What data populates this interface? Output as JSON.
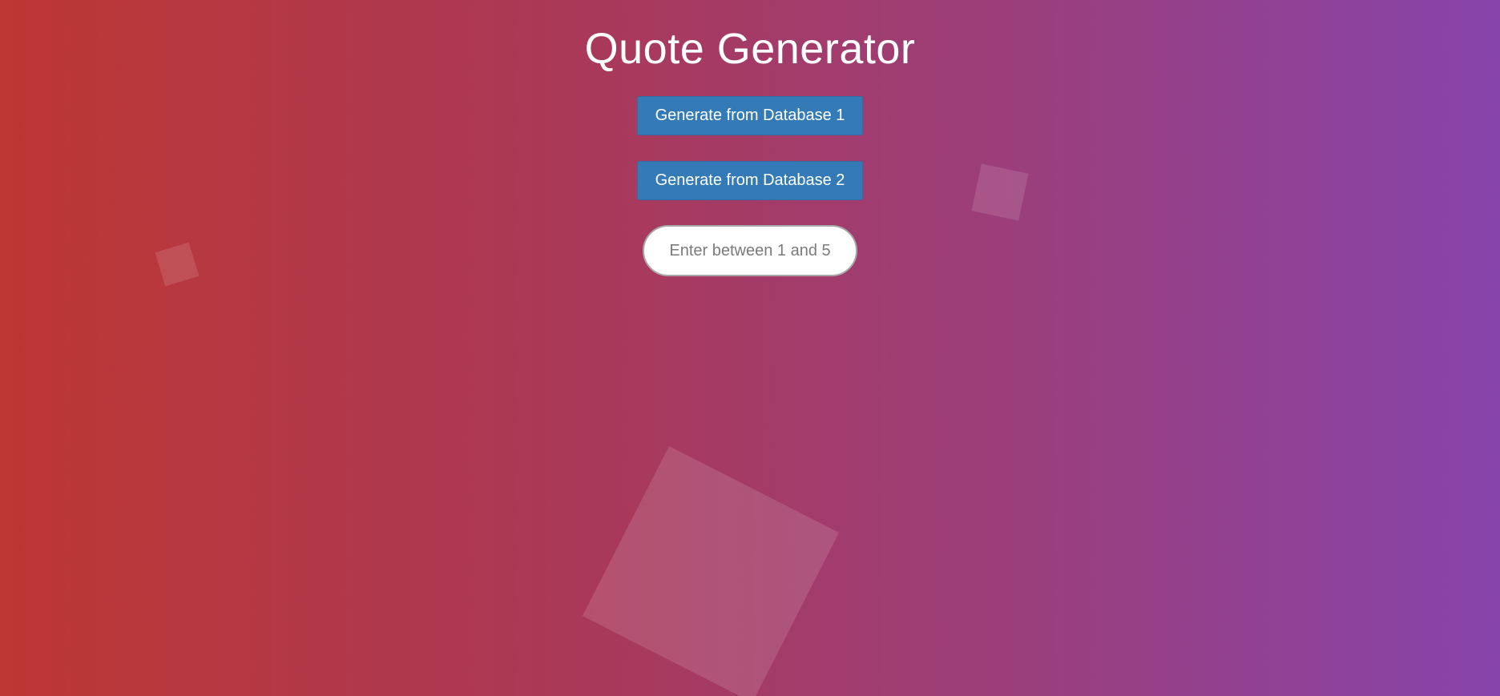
{
  "page": {
    "title": "Quote Generator"
  },
  "buttons": {
    "database1_label": "Generate from Database 1",
    "database2_label": "Generate from Database 2"
  },
  "input": {
    "value": "",
    "placeholder": "Enter between 1 and 5"
  },
  "colors": {
    "background_gradient": [
      "#bd3733",
      "#8744ab"
    ],
    "button": "#337ab7",
    "title_text": "#ffffff"
  }
}
